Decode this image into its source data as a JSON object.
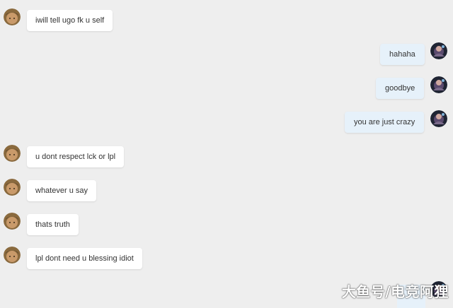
{
  "colors": {
    "background": "#eeeeee",
    "incoming_bubble": "#ffffff",
    "outgoing_bubble": "#e6f1fa",
    "text": "#333333"
  },
  "messages": [
    {
      "side": "incoming",
      "avatar": "user-avatar-icon",
      "text": "iwill tell ugo fk u self"
    },
    {
      "side": "outgoing",
      "avatar": "self-avatar-icon",
      "text": "hahaha"
    },
    {
      "side": "outgoing",
      "avatar": "self-avatar-icon",
      "text": "goodbye"
    },
    {
      "side": "outgoing",
      "avatar": "self-avatar-icon",
      "text": "you are just crazy"
    },
    {
      "side": "incoming",
      "avatar": "user-avatar-icon",
      "text": "u dont respect lck or lpl"
    },
    {
      "side": "incoming",
      "avatar": "user-avatar-icon",
      "text": "whatever u say"
    },
    {
      "side": "incoming",
      "avatar": "user-avatar-icon",
      "text": "thats truth"
    },
    {
      "side": "incoming",
      "avatar": "user-avatar-icon",
      "text": "lpl dont need u blessing idiot"
    }
  ],
  "watermark": "大鱼号/电竞阿狸"
}
